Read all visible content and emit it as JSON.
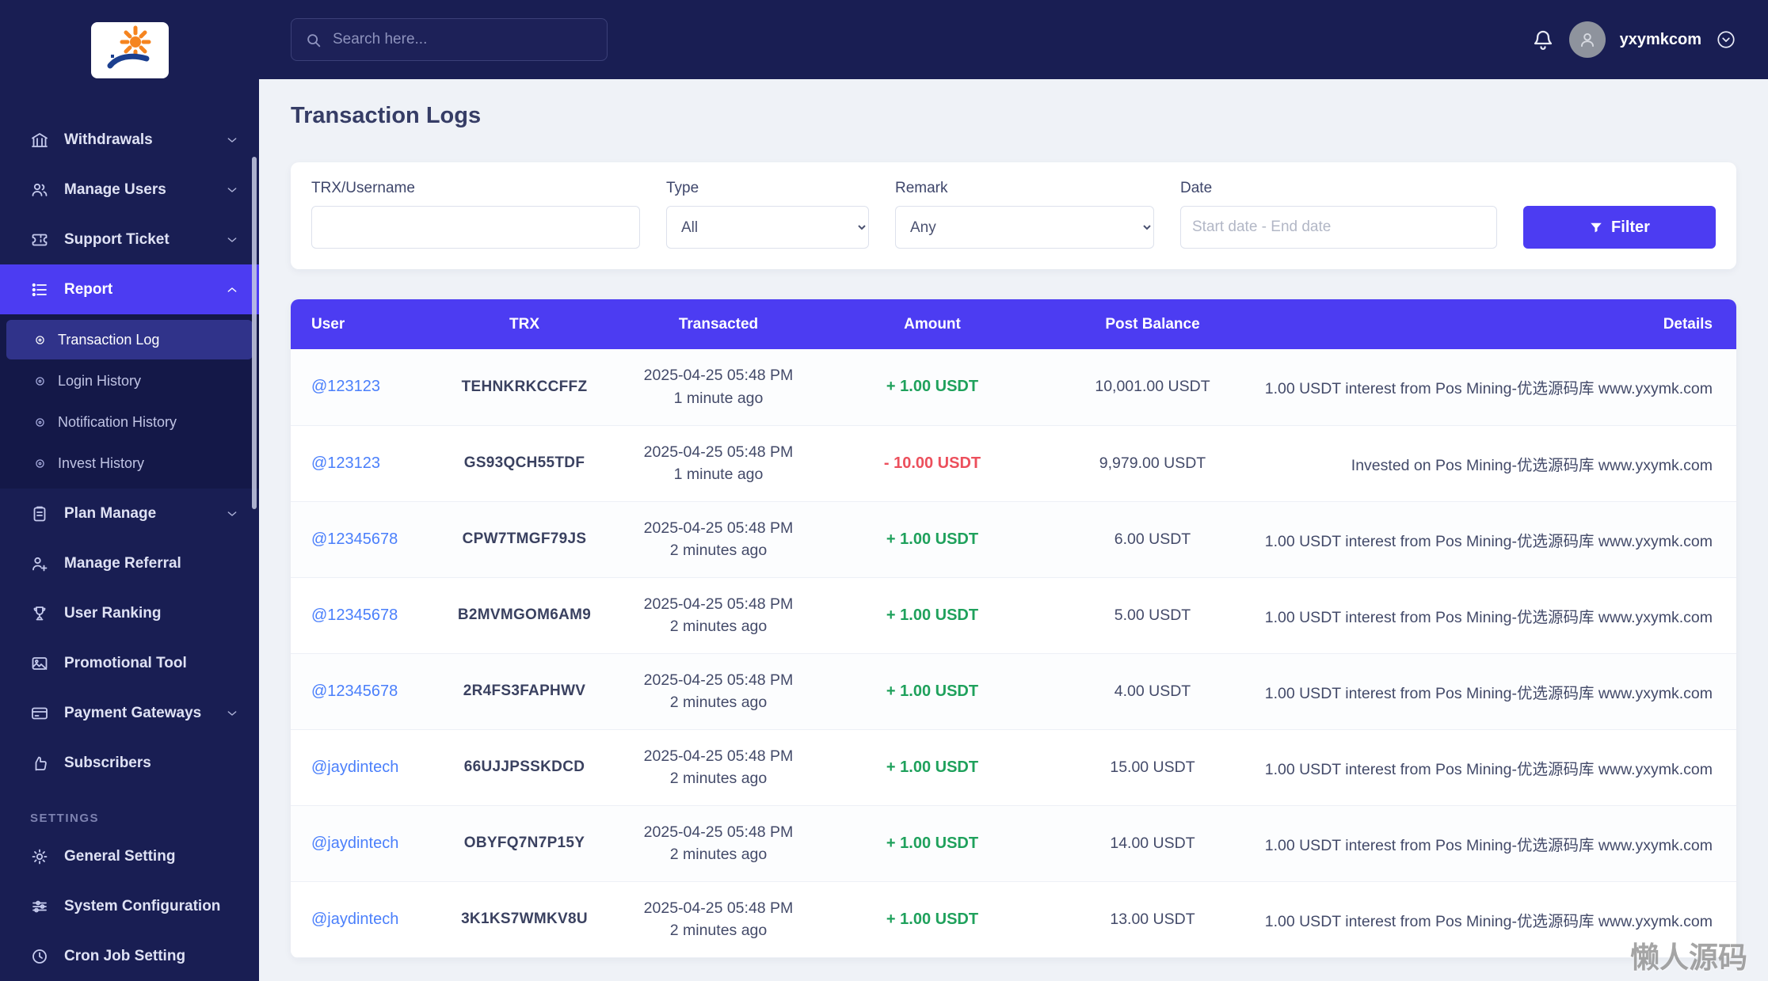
{
  "app": {
    "watermark": "懒人源码"
  },
  "topbar": {
    "search_placeholder": "Search here...",
    "username": "yxymkcom"
  },
  "sidebar": {
    "items": [
      {
        "label": "Withdrawals",
        "icon": "bank-icon"
      },
      {
        "label": "Manage Users",
        "icon": "users-icon"
      },
      {
        "label": "Support Ticket",
        "icon": "ticket-icon"
      },
      {
        "label": "Report",
        "icon": "report-icon"
      },
      {
        "label": "Plan Manage",
        "icon": "clipboard-icon"
      },
      {
        "label": "Manage Referral",
        "icon": "referral-icon"
      },
      {
        "label": "User Ranking",
        "icon": "ranking-icon"
      },
      {
        "label": "Promotional Tool",
        "icon": "image-icon"
      },
      {
        "label": "Payment Gateways",
        "icon": "credit-card-icon"
      },
      {
        "label": "Subscribers",
        "icon": "thumbs-up-icon"
      }
    ],
    "report_submenu": [
      {
        "label": "Transaction Log"
      },
      {
        "label": "Login History"
      },
      {
        "label": "Notification History"
      },
      {
        "label": "Invest History"
      }
    ],
    "section_label": "SETTINGS",
    "settings_items": [
      {
        "label": "General Setting",
        "icon": "gear-icon"
      },
      {
        "label": "System Configuration",
        "icon": "sliders-icon"
      },
      {
        "label": "Cron Job Setting",
        "icon": "clock-icon"
      }
    ]
  },
  "page": {
    "title": "Transaction Logs"
  },
  "filters": {
    "trx_username_label": "TRX/Username",
    "type_label": "Type",
    "type_value": "All",
    "remark_label": "Remark",
    "remark_value": "Any",
    "date_label": "Date",
    "date_placeholder": "Start date - End date",
    "filter_button": "Filter"
  },
  "table": {
    "headers": [
      "User",
      "TRX",
      "Transacted",
      "Amount",
      "Post Balance",
      "Details"
    ],
    "rows": [
      {
        "user": "@123123",
        "trx": "TEHNKRKCCFFZ",
        "date": "2025-04-25 05:48 PM",
        "ago": "1 minute ago",
        "amount": "+ 1.00 USDT",
        "post_balance": "10,001.00 USDT",
        "details": "1.00 USDT interest from Pos Mining-优选源码库 www.yxymk.com"
      },
      {
        "user": "@123123",
        "trx": "GS93QCH55TDF",
        "date": "2025-04-25 05:48 PM",
        "ago": "1 minute ago",
        "amount": "- 10.00 USDT",
        "post_balance": "9,979.00 USDT",
        "details": "Invested on Pos Mining-优选源码库 www.yxymk.com"
      },
      {
        "user": "@12345678",
        "trx": "CPW7TMGF79JS",
        "date": "2025-04-25 05:48 PM",
        "ago": "2 minutes ago",
        "amount": "+ 1.00 USDT",
        "post_balance": "6.00 USDT",
        "details": "1.00 USDT interest from Pos Mining-优选源码库 www.yxymk.com"
      },
      {
        "user": "@12345678",
        "trx": "B2MVMGOM6AM9",
        "date": "2025-04-25 05:48 PM",
        "ago": "2 minutes ago",
        "amount": "+ 1.00 USDT",
        "post_balance": "5.00 USDT",
        "details": "1.00 USDT interest from Pos Mining-优选源码库 www.yxymk.com"
      },
      {
        "user": "@12345678",
        "trx": "2R4FS3FAPHWV",
        "date": "2025-04-25 05:48 PM",
        "ago": "2 minutes ago",
        "amount": "+ 1.00 USDT",
        "post_balance": "4.00 USDT",
        "details": "1.00 USDT interest from Pos Mining-优选源码库 www.yxymk.com"
      },
      {
        "user": "@jaydintech",
        "trx": "66UJJPSSKDCD",
        "date": "2025-04-25 05:48 PM",
        "ago": "2 minutes ago",
        "amount": "+ 1.00 USDT",
        "post_balance": "15.00 USDT",
        "details": "1.00 USDT interest from Pos Mining-优选源码库 www.yxymk.com"
      },
      {
        "user": "@jaydintech",
        "trx": "OBYFQ7N7P15Y",
        "date": "2025-04-25 05:48 PM",
        "ago": "2 minutes ago",
        "amount": "+ 1.00 USDT",
        "post_balance": "14.00 USDT",
        "details": "1.00 USDT interest from Pos Mining-优选源码库 www.yxymk.com"
      },
      {
        "user": "@jaydintech",
        "trx": "3K1KS7WMKV8U",
        "date": "2025-04-25 05:48 PM",
        "ago": "2 minutes ago",
        "amount": "+ 1.00 USDT",
        "post_balance": "13.00 USDT",
        "details": "1.00 USDT interest from Pos Mining-优选源码库 www.yxymk.com"
      }
    ]
  },
  "colors": {
    "primary": "#4c3cf2",
    "success": "#1fa15c",
    "danger": "#ec4f5c",
    "sidebar_bg": "#191e53",
    "link": "#4a7ffb"
  }
}
